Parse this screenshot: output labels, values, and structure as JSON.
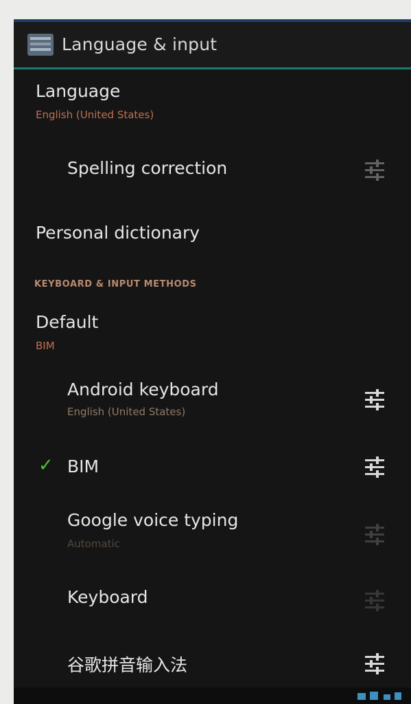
{
  "header": {
    "title": "Language & input",
    "icon": "settings-app-icon"
  },
  "language": {
    "title": "Language",
    "summary": "English (United States)"
  },
  "spelling": {
    "title": "Spelling correction",
    "icon": "settings-sliders-icon"
  },
  "dictionary": {
    "title": "Personal dictionary"
  },
  "section": {
    "keyboard_header": "KEYBOARD & INPUT METHODS"
  },
  "default": {
    "title": "Default",
    "summary": "BIM"
  },
  "input_methods": [
    {
      "title": "Android keyboard",
      "summary": "English (United States)",
      "checked": false,
      "icon": "settings-sliders-icon"
    },
    {
      "title": "BIM",
      "summary": "",
      "checked": true,
      "icon": "settings-sliders-icon"
    },
    {
      "title": "Google voice typing",
      "summary": "Automatic",
      "checked": false,
      "icon": "settings-sliders-icon"
    },
    {
      "title": "Keyboard",
      "summary": "",
      "checked": false,
      "icon": "settings-sliders-icon"
    },
    {
      "title": "谷歌拼音输入法",
      "summary": "",
      "checked": false,
      "icon": "settings-sliders-icon"
    }
  ],
  "colors": {
    "background": "#151515",
    "accent_divider": "#1f7a6e",
    "summary_text": "#c07050",
    "check": "#4fbf3a"
  }
}
